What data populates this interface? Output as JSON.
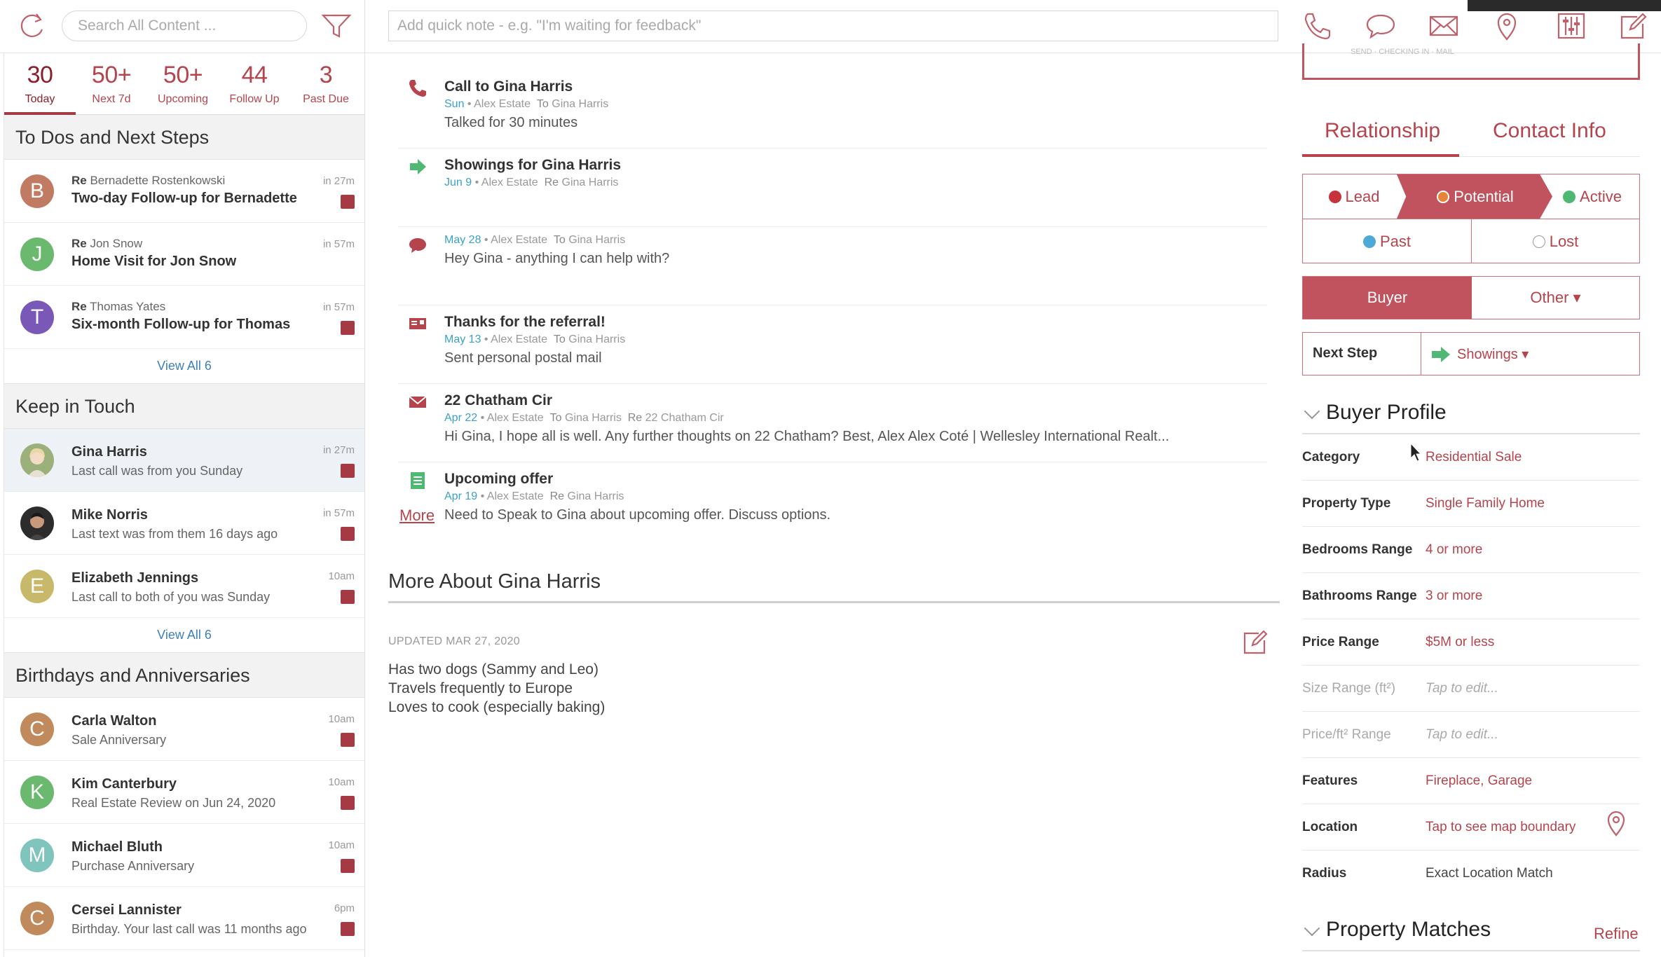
{
  "topbar": {
    "search_placeholder": "Search All Content ...",
    "quicknote_placeholder": "Add quick note - e.g. \"I'm waiting for feedback\""
  },
  "stats": [
    {
      "num": "30",
      "label": "Today"
    },
    {
      "num": "50+",
      "label": "Next 7d"
    },
    {
      "num": "50+",
      "label": "Upcoming"
    },
    {
      "num": "44",
      "label": "Follow Up"
    },
    {
      "num": "3",
      "label": "Past Due"
    }
  ],
  "todos": {
    "heading": "To Dos and Next Steps",
    "items": [
      {
        "initial": "B",
        "re_label": "Re",
        "re": "Bernadette Rostenkowski",
        "title": "Two-day Follow-up for Bernadette",
        "time": "in 27m"
      },
      {
        "initial": "J",
        "re_label": "Re",
        "re": "Jon Snow",
        "title": "Home Visit for Jon Snow",
        "time": "in 57m"
      },
      {
        "initial": "T",
        "re_label": "Re",
        "re": "Thomas Yates",
        "title": "Six-month Follow-up for Thomas",
        "time": "in 57m"
      }
    ],
    "view_all": "View All 6"
  },
  "keep": {
    "heading": "Keep in Touch",
    "items": [
      {
        "name": "Gina Harris",
        "sub": "Last call was from you Sunday",
        "time": "in 27m"
      },
      {
        "name": "Mike Norris",
        "sub": "Last text was from them 16 days ago",
        "time": "in 57m"
      },
      {
        "initial": "E",
        "name": "Elizabeth Jennings",
        "sub": "Last call to both of you was Sunday",
        "time": "10am"
      }
    ],
    "view_all": "View All 6"
  },
  "birthdays": {
    "heading": "Birthdays and Anniversaries",
    "items": [
      {
        "initial": "C",
        "name": "Carla Walton",
        "sub": "Sale Anniversary",
        "time": "10am"
      },
      {
        "initial": "K",
        "name": "Kim Canterbury",
        "sub": "Real Estate Review on Jun 24, 2020",
        "time": "10am"
      },
      {
        "initial": "M",
        "name": "Michael Bluth",
        "sub": "Purchase Anniversary",
        "time": "10am"
      },
      {
        "initial": "C",
        "name": "Cersei Lannister",
        "sub": "Birthday. Your last call was 11 months ago",
        "time": "6pm"
      }
    ]
  },
  "timeline": [
    {
      "title": "Call to Gina Harris",
      "date": "Sun",
      "sep": "•",
      "agent": "Alex Estate",
      "rel_label": "To",
      "rel": "Gina Harris",
      "body": "Talked for 30 minutes"
    },
    {
      "title": "Showings for Gina Harris",
      "date": "Jun 9",
      "sep": "•",
      "agent": "Alex Estate",
      "rel_label": "Re",
      "rel": "Gina Harris",
      "body": ""
    },
    {
      "title": "",
      "date": "May 28",
      "sep": "•",
      "agent": "Alex Estate",
      "rel_label": "To",
      "rel": "Gina Harris",
      "body": "Hey Gina - anything I can help with?"
    },
    {
      "title": "Thanks for the referral!",
      "date": "May 13",
      "sep": "•",
      "agent": "Alex Estate",
      "rel_label": "To",
      "rel": "Gina Harris",
      "body": "Sent personal postal mail"
    },
    {
      "title": "22 Chatham Cir",
      "date": "Apr 22",
      "sep": "•",
      "agent": "Alex Estate",
      "rel_label": "To",
      "rel": "Gina Harris",
      "rel2_label": "Re",
      "rel2": "22 Chatham Cir",
      "body": "Hi Gina, I hope all is well. Any further thoughts on 22 Chatham? Best, Alex Alex Coté  | Wellesley International Realt..."
    },
    {
      "title": "Upcoming offer",
      "date": "Apr 19",
      "sep": "•",
      "agent": "Alex Estate",
      "rel_label": "Re",
      "rel": "Gina Harris",
      "body": "Need to Speak to Gina about upcoming offer. Discuss options."
    }
  ],
  "more_link": "More",
  "more_about": {
    "heading": "More About Gina Harris",
    "updated": "UPDATED MAR 27, 2020",
    "notes": [
      "Has two dogs (Sammy and Leo)",
      "Travels frequently to Europe",
      "Loves to cook (especially baking)"
    ]
  },
  "right": {
    "topcard_text": "SEND · CHECKING IN · MAIL",
    "tabs": {
      "relationship": "Relationship",
      "contact": "Contact Info"
    },
    "stages": {
      "lead": "Lead",
      "potential": "Potential",
      "active": "Active",
      "past": "Past",
      "lost": "Lost"
    },
    "buyer": "Buyer",
    "other": "Other ▾",
    "next_step_label": "Next Step",
    "next_step_value": "Showings ▾",
    "buyer_profile": "Buyer Profile",
    "profile": [
      {
        "k": "Category",
        "v": "Residential Sale"
      },
      {
        "k": "Property Type",
        "v": "Single Family Home"
      },
      {
        "k": "Bedrooms Range",
        "v": "4 or more"
      },
      {
        "k": "Bathrooms Range",
        "v": "3 or more"
      },
      {
        "k": "Price Range",
        "v": "$5M or less"
      },
      {
        "k": "Size Range (ft²)",
        "v": "Tap to edit..."
      },
      {
        "k": "Price/ft² Range",
        "v": "Tap to edit..."
      },
      {
        "k": "Features",
        "v": "Fireplace, Garage"
      },
      {
        "k": "Location",
        "v": "Tap to see map boundary"
      },
      {
        "k": "Radius",
        "v": "Exact Location Match"
      }
    ],
    "property_matches": "Property Matches",
    "refine": "Refine"
  },
  "colors": {
    "accent": "#b5444d",
    "accent_fill": "#c0535d",
    "date_blue": "#3aa1c9",
    "link_blue": "#3f7fbf",
    "lead": "#c8323d",
    "potential": "#e8833a",
    "active": "#4fb873",
    "past": "#4da9d6"
  }
}
